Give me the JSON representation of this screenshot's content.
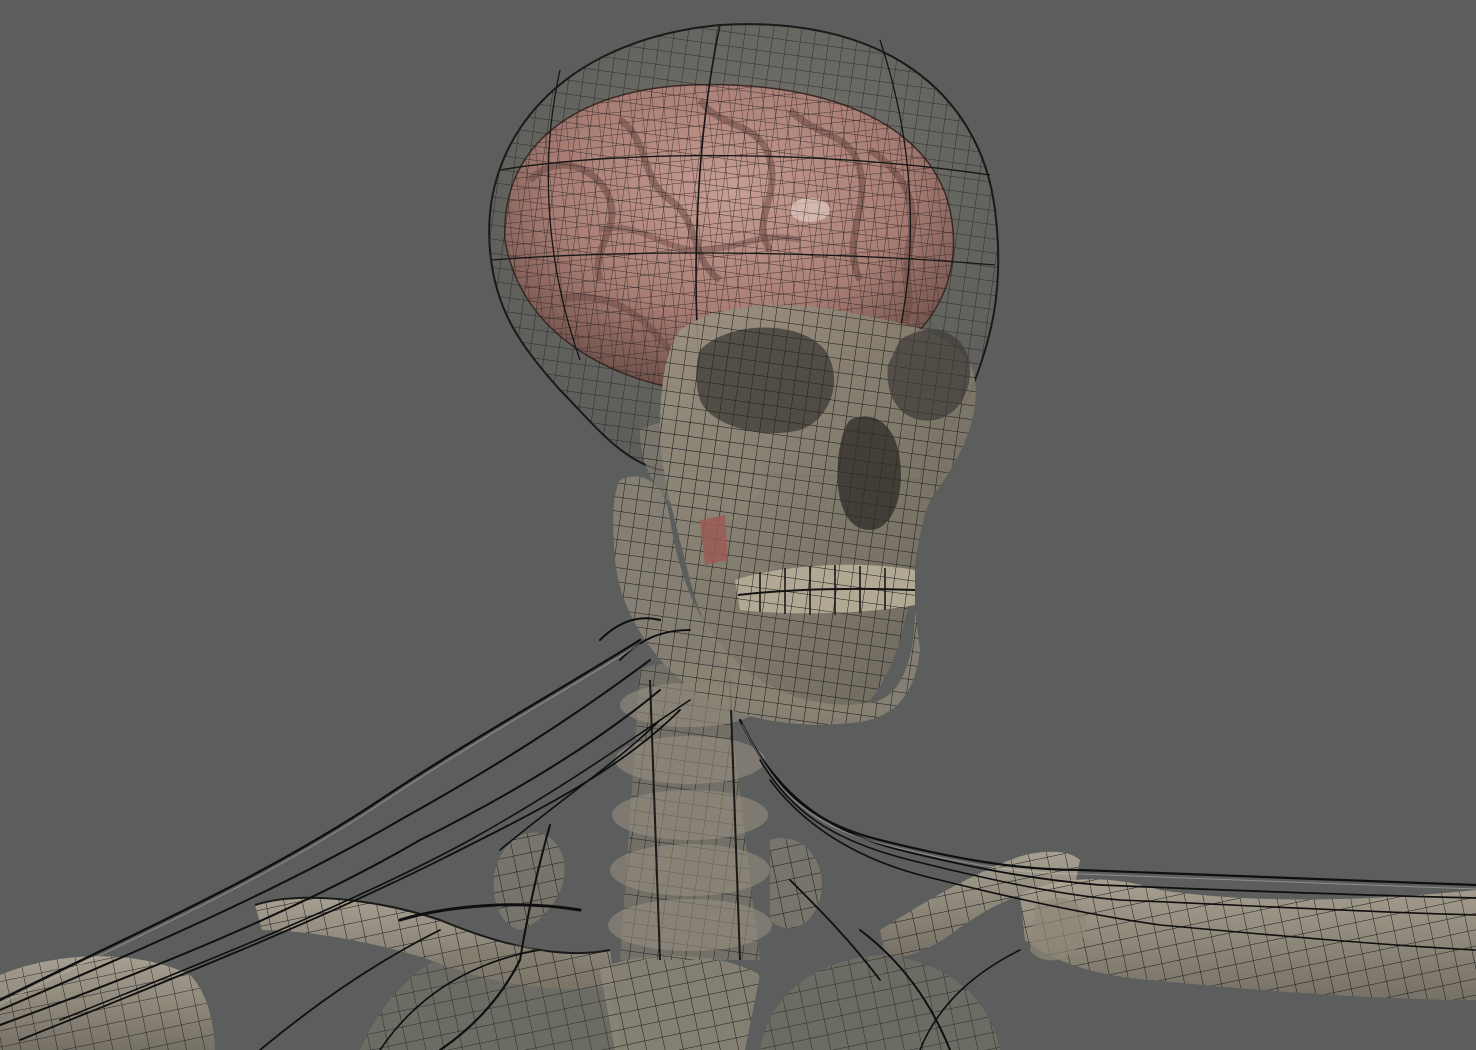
{
  "scene": {
    "background_color": "#5b5e5d",
    "subject": "wireframe-anatomy-head-neck-shoulders",
    "colors": {
      "bone": "#a9a08f",
      "bone_shadow": "#6f685c",
      "brain": "#b48a80",
      "brain_shadow": "#7d5750",
      "wire": "#151515",
      "nerve": "#0e0e0e",
      "muscle_accent": "#9a5a55"
    }
  }
}
